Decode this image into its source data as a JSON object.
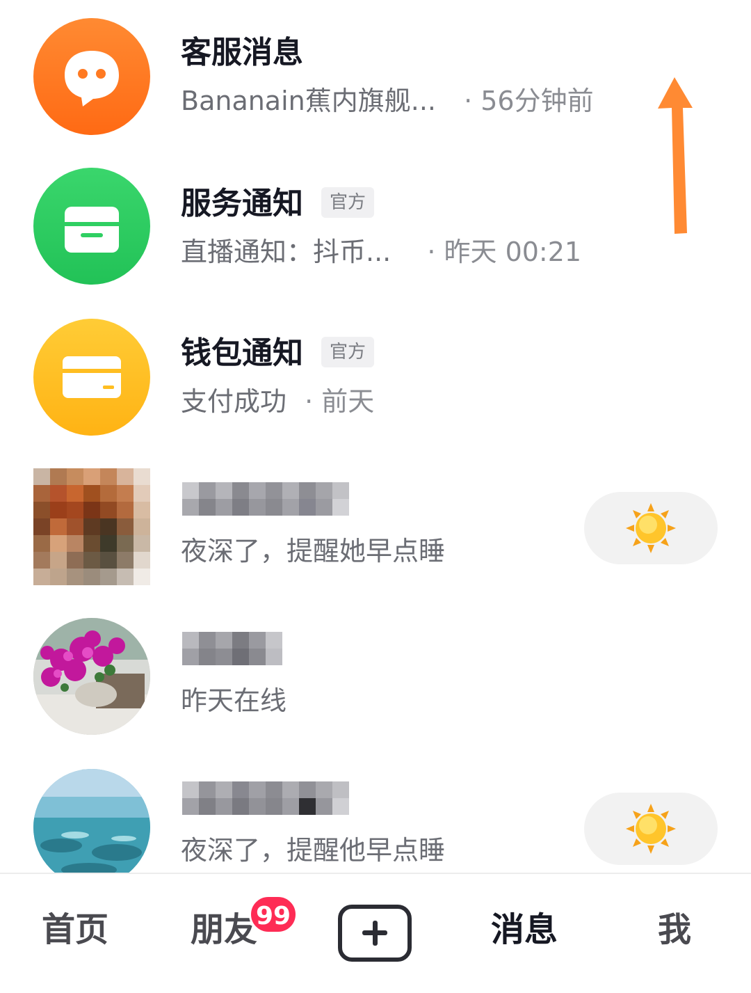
{
  "messages": [
    {
      "name": "客服消息",
      "subtitle": "Bananain蕉内旗舰...",
      "time": "· 56分钟前",
      "avatar_color": "#ff7a22",
      "icon": "chat-bubble-icon"
    },
    {
      "name": "服务通知",
      "tag": "官方",
      "subtitle": "直播通知：抖币...",
      "time": "· 昨天 00:21",
      "avatar_color": "#2fcf62",
      "icon": "inbox-tray-icon"
    },
    {
      "name": "钱包通知",
      "tag": "官方",
      "subtitle": "支付成功",
      "time": "· 前天",
      "avatar_color": "#ffbe21",
      "icon": "card-icon"
    },
    {
      "subtitle": "夜深了，提醒她早点睡",
      "action_icon": "sun-icon"
    },
    {
      "subtitle": "昨天在线"
    },
    {
      "subtitle": "夜深了，提醒他早点睡",
      "action_icon": "sun-icon"
    }
  ],
  "annotation": {
    "arrow_color": "#ff8a33",
    "icon": "up-arrow-icon"
  },
  "tabbar": {
    "home": "首页",
    "friends": "朋友",
    "friends_badge": "99",
    "create_icon": "plus-icon",
    "messages": "消息",
    "me": "我"
  },
  "colors": {
    "badge": "#fe2c55",
    "text_primary": "#161823",
    "text_secondary": "#6b6d74"
  }
}
